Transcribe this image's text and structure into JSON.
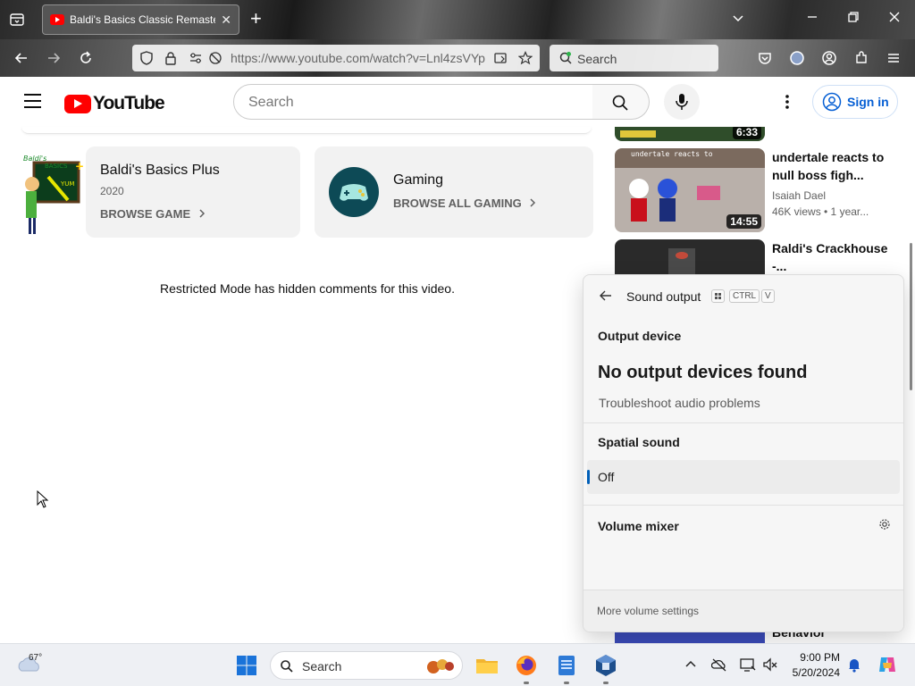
{
  "browser": {
    "tab_title": "Baldi's Basics Classic Remaster...",
    "tab_close": "✕",
    "new_tab": "+",
    "url": "https://www.youtube.com/watch?v=Lnl4zsVYp",
    "search_placeholder": "Search"
  },
  "youtube": {
    "logo_text": "YouTube",
    "search_placeholder": "Search",
    "sign_in": "Sign in",
    "colors": {
      "brand_red": "#ff0000",
      "link_blue": "#065fd4"
    }
  },
  "main": {
    "game_card": {
      "title": "Baldi's Basics Plus",
      "year": "2020",
      "browse": "BROWSE GAME"
    },
    "gaming_card": {
      "title": "Gaming",
      "browse": "BROWSE ALL GAMING"
    },
    "restricted_notice": "Restricted Mode has hidden comments for this video."
  },
  "sidebar": {
    "items": [
      {
        "duration": "6:33"
      },
      {
        "title": "undertale reacts to null boss figh...",
        "channel": "Isaiah Dael",
        "meta": "46K views  •  1 year...",
        "duration": "14:55",
        "thumb_caption": "undertale reacts to"
      },
      {
        "title": "Raldi's Crackhouse -..."
      },
      {
        "title": "Behavior"
      }
    ]
  },
  "flyout": {
    "title": "Sound output",
    "shortcut_ctrl": "CTRL",
    "shortcut_v": "V",
    "output_heading": "Output device",
    "no_devices": "No output devices found",
    "troubleshoot": "Troubleshoot audio problems",
    "spatial_heading": "Spatial sound",
    "spatial_value": "Off",
    "mixer_heading": "Volume mixer",
    "more_settings": "More volume settings",
    "accent": "#005fb8"
  },
  "taskbar": {
    "temperature": "67°",
    "search_label": "Search",
    "time": "9:00 PM",
    "date": "5/20/2024"
  }
}
